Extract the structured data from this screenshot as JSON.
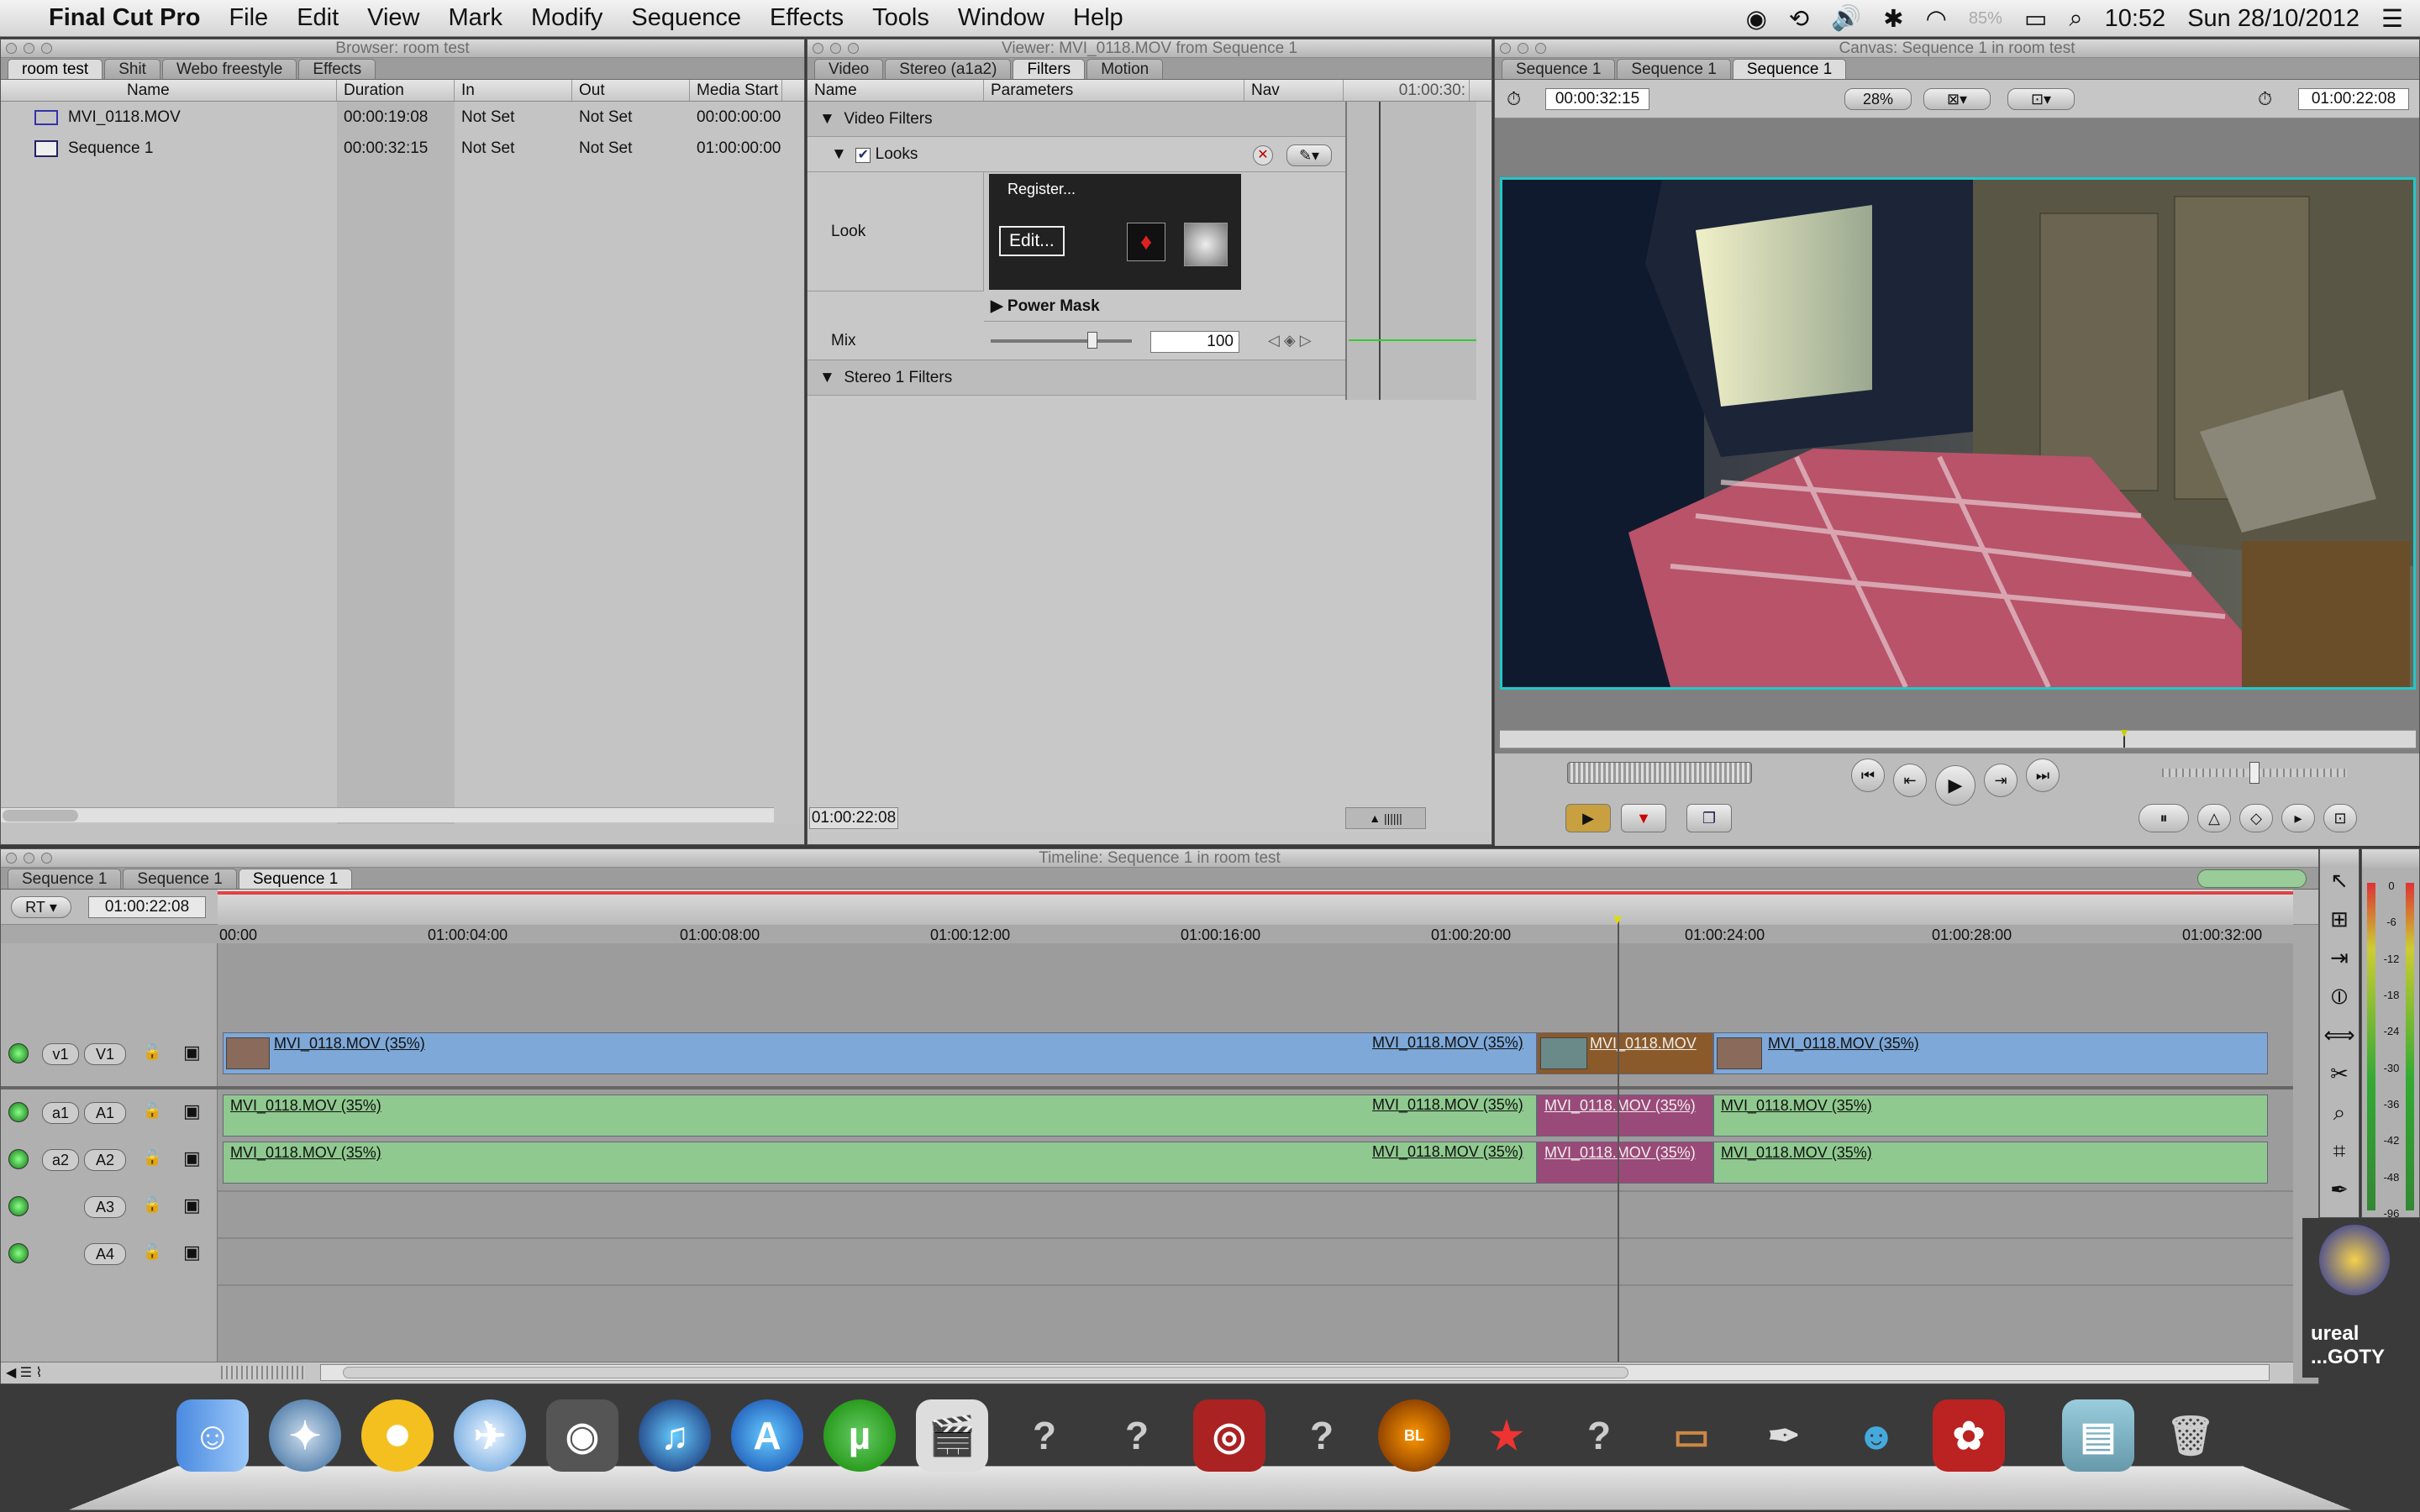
{
  "menubar": {
    "app_name": "Final Cut Pro",
    "menus": [
      "File",
      "Edit",
      "View",
      "Mark",
      "Modify",
      "Sequence",
      "Effects",
      "Tools",
      "Window",
      "Help"
    ],
    "clock": "10:52",
    "date": "Sun 28/10/2012",
    "battery_label": "85%"
  },
  "browser": {
    "title": "Browser: room test",
    "tabs": [
      "room test",
      "Shit",
      "Webo freestyle",
      "Effects"
    ],
    "columns": [
      "Name",
      "Duration",
      "In",
      "Out",
      "Media Start"
    ],
    "rows": [
      {
        "name": "MVI_0118.MOV",
        "duration": "00:00:19:08",
        "in": "Not Set",
        "out": "Not Set",
        "media_start": "00:00:00:00"
      },
      {
        "name": "Sequence 1",
        "duration": "00:00:32:15",
        "in": "Not Set",
        "out": "Not Set",
        "media_start": "01:00:00:00"
      }
    ]
  },
  "viewer": {
    "title": "Viewer: MVI_0118.MOV from Sequence 1",
    "tabs": [
      "Video",
      "Stereo (a1a2)",
      "Filters",
      "Motion"
    ],
    "columns": [
      "Name",
      "Parameters",
      "Nav"
    ],
    "ruler_time": "01:00:30:",
    "video_filters": "Video Filters",
    "looks": "Looks",
    "look_label": "Look",
    "register": "Register...",
    "edit": "Edit...",
    "power_mask": "Power Mask",
    "mix_label": "Mix",
    "mix_value": "100",
    "mix_fraction": 0.72,
    "stereo_filters": "Stereo 1 Filters",
    "timecode": "01:00:22:08"
  },
  "canvas": {
    "title": "Canvas: Sequence 1 in room test",
    "tabs": [
      "Sequence 1",
      "Sequence 1",
      "Sequence 1"
    ],
    "duration": "00:00:32:15",
    "zoom": "28%",
    "current_time": "01:00:22:08"
  },
  "timeline": {
    "title": "Timeline: Sequence 1 in room test",
    "tabs": [
      "Sequence 1",
      "Sequence 1",
      "Sequence 1"
    ],
    "rt": "RT",
    "current_time": "01:00:22:08",
    "ruler": [
      "00:00",
      "01:00:04:00",
      "01:00:08:00",
      "01:00:12:00",
      "01:00:16:00",
      "01:00:20:00",
      "01:00:24:00",
      "01:00:28:00",
      "01:00:32:00"
    ],
    "tracks": [
      {
        "src": "v1",
        "dst": "V1"
      },
      {
        "src": "a1",
        "dst": "A1"
      },
      {
        "src": "a2",
        "dst": "A2"
      },
      {
        "src": "",
        "dst": "A3"
      },
      {
        "src": "",
        "dst": "A4"
      }
    ],
    "clip_label": "MVI_0118.MOV (35%)",
    "clip_label_short": "MVI_0118.MOV",
    "meter_scale": [
      "0",
      "-6",
      "-12",
      "-18",
      "-24",
      "-30",
      "-36",
      "-42",
      "-48",
      "-96"
    ]
  },
  "desktop": {
    "icon_label_1": "ureal",
    "icon_label_2": "...GOTY"
  },
  "colors": {
    "video_clip": "#7ea8d8",
    "audio_clip": "#8fc98f",
    "selected_audio": "#9a4a78",
    "selected_video": "#8a5a2a",
    "canvas_border": "#22c8c8"
  }
}
